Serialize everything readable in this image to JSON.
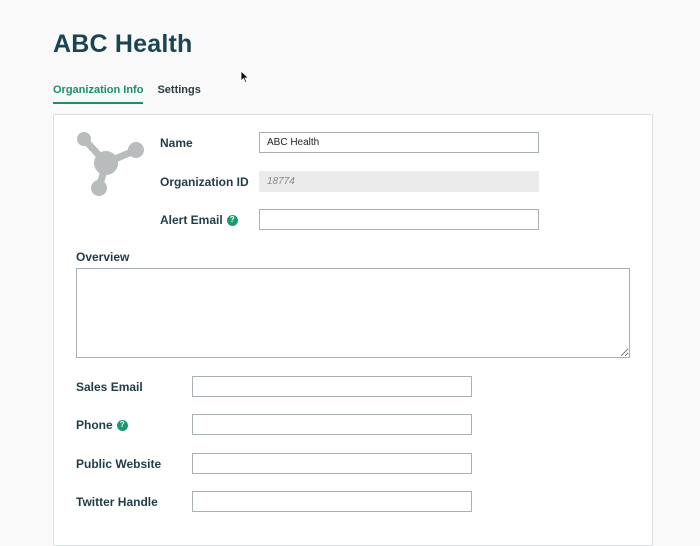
{
  "page": {
    "title": "ABC Health"
  },
  "tabs": [
    {
      "label": "Organization Info",
      "active": true
    },
    {
      "label": "Settings",
      "active": false
    }
  ],
  "org": {
    "logo_icon": "network-nodes-icon",
    "name_label": "Name",
    "name_value": "ABC Health",
    "org_id_label": "Organization ID",
    "org_id_value": "18774",
    "alert_email_label": "Alert Email",
    "alert_email_value": "",
    "overview_label": "Overview",
    "overview_value": "",
    "sales_email_label": "Sales Email",
    "sales_email_value": "",
    "phone_label": "Phone",
    "phone_value": "",
    "website_label": "Public Website",
    "website_value": "",
    "twitter_label": "Twitter Handle",
    "twitter_value": "",
    "help_icon": "question-circle-icon"
  },
  "colors": {
    "accent": "#1a8f6c",
    "title": "#1b4452",
    "logo": "#b9bcbd"
  }
}
